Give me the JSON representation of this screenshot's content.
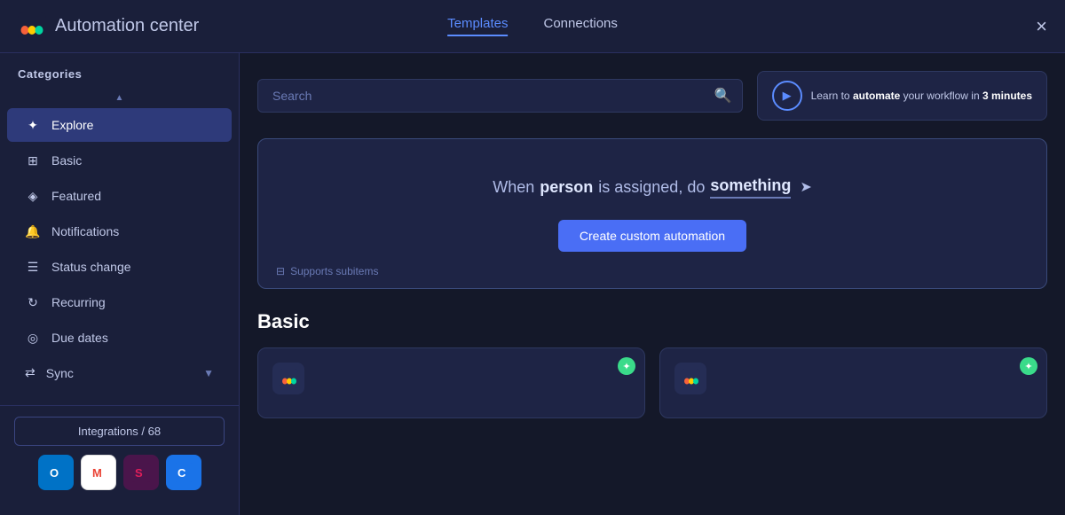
{
  "header": {
    "app_name": "Automation",
    "app_subtitle": " center",
    "tabs": [
      {
        "label": "Templates",
        "active": true
      },
      {
        "label": "Connections",
        "active": false
      }
    ],
    "close_label": "×"
  },
  "sidebar": {
    "categories_label": "Categories",
    "items": [
      {
        "id": "explore",
        "label": "Explore",
        "icon": "✦",
        "active": true
      },
      {
        "id": "basic",
        "label": "Basic",
        "icon": "⊞",
        "active": false
      },
      {
        "id": "featured",
        "label": "Featured",
        "icon": "◈",
        "active": false
      },
      {
        "id": "notifications",
        "label": "Notifications",
        "icon": "🔔",
        "active": false
      },
      {
        "id": "status-change",
        "label": "Status change",
        "icon": "☰",
        "active": false
      },
      {
        "id": "recurring",
        "label": "Recurring",
        "icon": "↻",
        "active": false
      },
      {
        "id": "due-dates",
        "label": "Due dates",
        "icon": "◎",
        "active": false
      }
    ],
    "sync_item": {
      "label": "Sync",
      "icon": "⇄"
    },
    "integrations_btn": "Integrations / 68",
    "integration_icons": [
      {
        "id": "outlook",
        "bg": "#0072c6",
        "char": "O"
      },
      {
        "id": "gmail",
        "bg": "#ea4335",
        "char": "M"
      },
      {
        "id": "slack",
        "bg": "#4a154b",
        "char": "S"
      },
      {
        "id": "calendar",
        "bg": "#1a73e8",
        "char": "C"
      }
    ]
  },
  "search": {
    "placeholder": "Search",
    "value": ""
  },
  "video_promo": {
    "text_before_bold": "Learn to ",
    "bold_word": "automate",
    "text_after_bold": " your workflow in ",
    "bold_minutes": "3 minutes"
  },
  "custom_automation": {
    "sentence_start": "When ",
    "bold_person": "person",
    "sentence_mid": " is assigned, do ",
    "bold_something": "something",
    "create_btn_label": "Create custom automation",
    "supports_label": "Supports subitems"
  },
  "basic_section": {
    "heading": "Basic",
    "cards": [
      {
        "id": "card1",
        "badge": "✦"
      },
      {
        "id": "card2",
        "badge": "✦"
      }
    ]
  }
}
